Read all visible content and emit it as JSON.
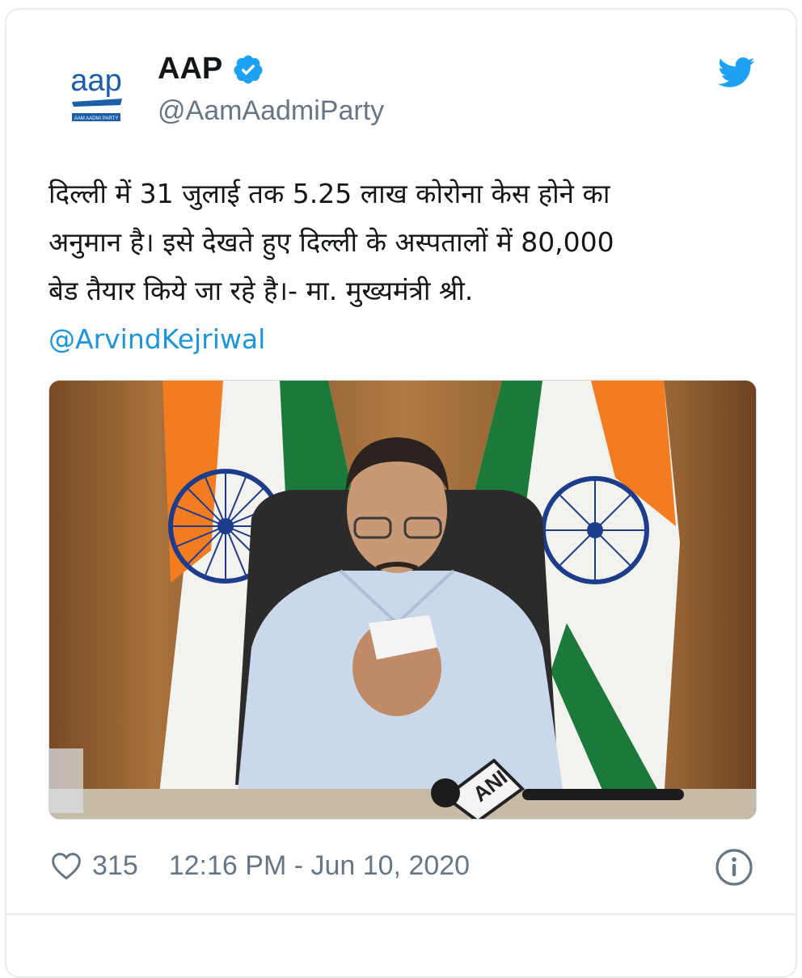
{
  "tweet": {
    "logo_text": "aap",
    "logo_subtext": "AAM AADMI PARTY",
    "display_name": "AAP",
    "handle": "@AamAadmiParty",
    "text_lines": [
      "दिल्ली में 31 जुलाई तक 5.25 लाख कोरोना केस होने का",
      "अनुमान है। इसे देखते हुए दिल्ली के अस्पतालों में 80,000",
      "बेड तैयार किये जा रहे है।- मा. मुख्यमंत्री श्री."
    ],
    "mention": "@ArvindKejriwal",
    "media_watermark": "ANI",
    "likes": "315",
    "timestamp": "12:16 PM - Jun 10, 2020"
  },
  "colors": {
    "accent": "#1da1f2",
    "mention": "#1b95e0",
    "muted": "#657786",
    "text": "#14171a"
  },
  "icons": [
    "verified-badge-icon",
    "twitter-bird-icon",
    "heart-icon",
    "info-icon"
  ]
}
